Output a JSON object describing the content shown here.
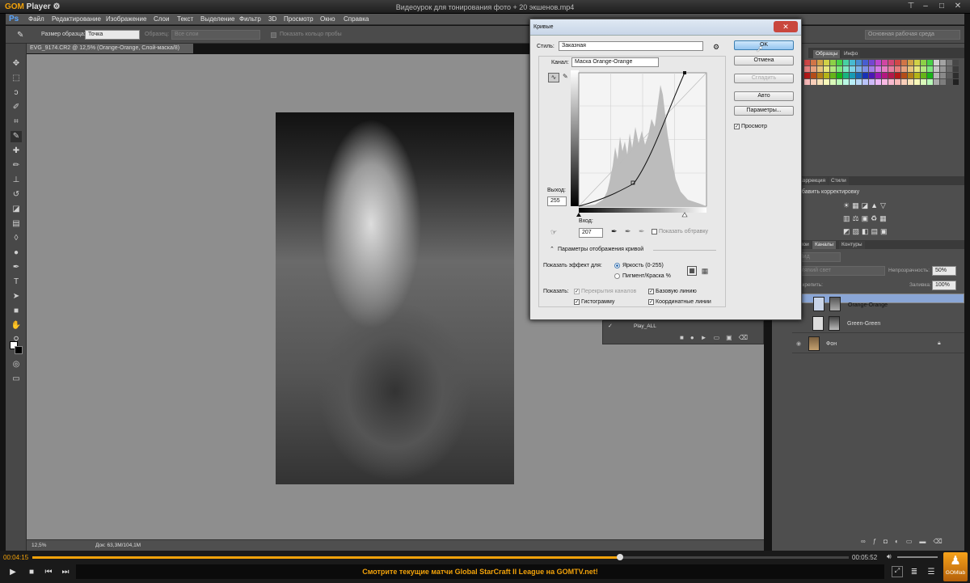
{
  "player": {
    "logo_gom": "GOM",
    "logo_player": "Player",
    "gear": "⚙",
    "title": "Видеоурок для тонирования фото + 20 экшенов.mp4",
    "time_elapsed": "00:04:15",
    "time_total": "00:05:52",
    "marquee": "Смотрите текущие матчи Global StarCraft II League на GOMTV.net!",
    "progress": 0.72,
    "gomlab_label": "GOMlab"
  },
  "ps": {
    "logo": "Ps",
    "menu": [
      "Файл",
      "Редактирование",
      "Изображение",
      "Слои",
      "Текст",
      "Выделение",
      "Фильтр",
      "3D",
      "Просмотр",
      "Окно",
      "Справка"
    ],
    "options": {
      "sample_size_label": "Размер образца:",
      "sample_size_value": "Точка",
      "sample_label": "Образец:",
      "sample_value": "Все слои",
      "ring_label": "Показать кольцо пробы",
      "workspace": "Основная рабочая среда"
    },
    "doc_tab": "EVG_9174.CR2 @ 12,5% (Orange-Orange, Слой-маска/8)",
    "zoom": "12,5%",
    "doc_info": "Док: 63,3M/104,1M"
  },
  "panels": {
    "tabs1": [
      "Образцы",
      "Инфо"
    ],
    "tabs2": [
      "Коррекция",
      "Стили"
    ],
    "add_adjust": "обавить корректировку",
    "tabs3": [
      "Слои",
      "Каналы",
      "Контуры"
    ],
    "kind": "Вид",
    "blend": "Мягкий свет",
    "opacity_label": "Непрозрачность:",
    "opacity_value": "50%",
    "lock_label": "Закрепить:",
    "fill_label": "Заливка:",
    "fill_value": "100%",
    "actions_item": "Play_ALL",
    "layers": [
      {
        "name": "Orange-Orange"
      },
      {
        "name": "Green-Green"
      },
      {
        "name": "Фон"
      }
    ]
  },
  "curves": {
    "title": "Кривые",
    "preset_label": "Стиль:",
    "preset_value": "Заказная",
    "channel_label": "Канал:",
    "channel_value": "Маска Orange-Orange",
    "ok": "OK",
    "cancel": "Отмена",
    "smooth": "Сгладить",
    "auto": "Авто",
    "options": "Параметры...",
    "preview": "Просмотр",
    "output_label": "Выход:",
    "output_value": "255",
    "input_label": "Вход:",
    "input_value": "207",
    "show_clipping": "Показать обтравку",
    "display_options": "Параметры отображения кривой",
    "show_amount_label": "Показать эффект для:",
    "light": "Яркость (0-255)",
    "pigment": "Пигмент/Краска %",
    "show_label": "Показать:",
    "channel_overlays": "Перекрытия каналов",
    "baseline": "Базовую линию",
    "histogram": "Гистограмму",
    "intersection": "Координатные линии"
  }
}
